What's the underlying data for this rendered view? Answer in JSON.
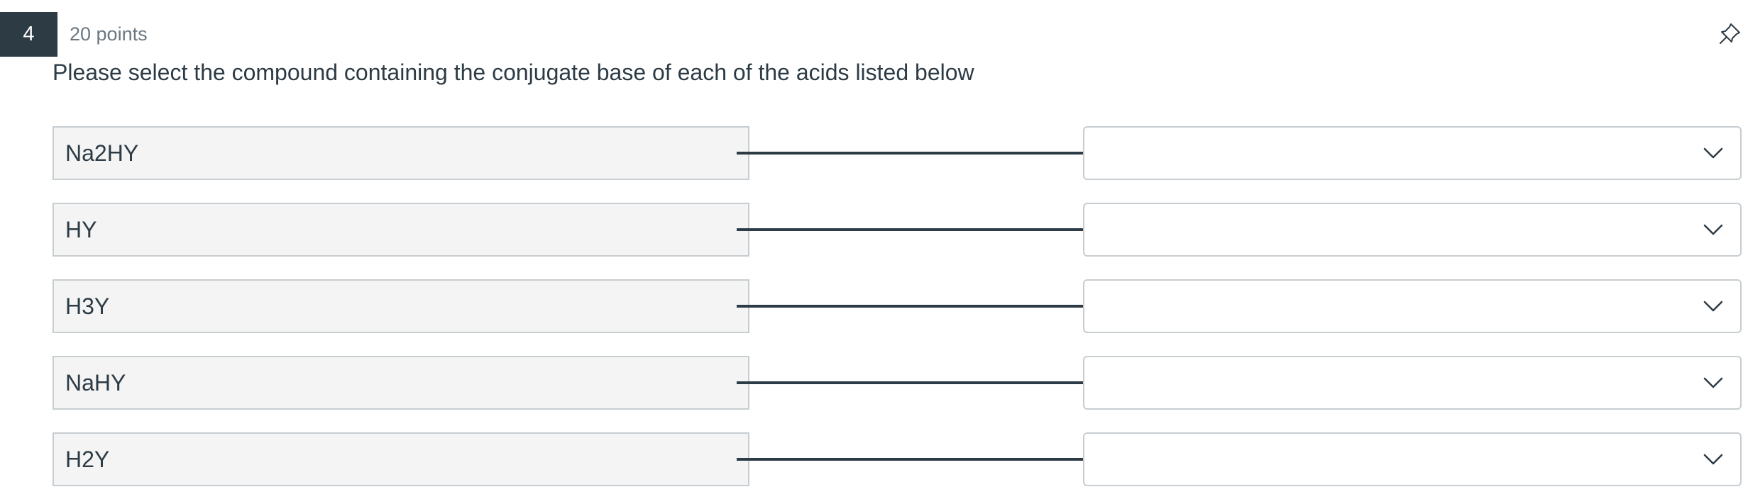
{
  "question": {
    "number": "4",
    "points": "20 points",
    "prompt": "Please select the compound containing the conjugate base of each of the acids listed below",
    "icons": {
      "pin": "pin-icon",
      "dropdown": "chevron-down-icon"
    }
  },
  "matches": [
    {
      "acid": "Na2HY",
      "selected": ""
    },
    {
      "acid": "HY",
      "selected": ""
    },
    {
      "acid": "H3Y",
      "selected": ""
    },
    {
      "acid": "NaHY",
      "selected": ""
    },
    {
      "acid": "H2Y",
      "selected": ""
    }
  ],
  "colors": {
    "accent_dark": "#2d3b45",
    "muted_text": "#6b7780",
    "label_bg": "#f4f4f4",
    "border": "#c7cdd1"
  }
}
